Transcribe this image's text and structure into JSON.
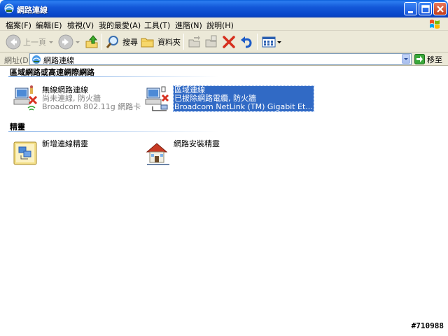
{
  "window": {
    "title": "網路連線",
    "icon": "network-connections-icon"
  },
  "menubar": {
    "items": [
      "檔案(F)",
      "編輯(E)",
      "檢視(V)",
      "我的最愛(A)",
      "工具(T)",
      "進階(N)",
      "說明(H)"
    ]
  },
  "toolbar": {
    "back_label": "上一頁",
    "search_label": "搜尋",
    "folders_label": "資料夾"
  },
  "address": {
    "label": "網址(D)",
    "value": "網路連線",
    "go_label": "移至"
  },
  "groups": [
    {
      "title": "區域網路或高速網際網路",
      "items": [
        {
          "name": "無線網路連線",
          "status": "尚未連線, 防火牆",
          "device": "Broadcom 802.11g 網路卡",
          "icon": "wireless-connection-icon",
          "selected": false
        },
        {
          "name": "區域連線",
          "status": "已拔除網路電纜, 防火牆",
          "device": "Broadcom NetLink (TM) Gigabit Et...",
          "icon": "lan-connection-icon",
          "selected": true
        }
      ]
    },
    {
      "title": "精靈",
      "items": [
        {
          "name": "新增連線精靈",
          "icon": "new-connection-wizard-icon"
        },
        {
          "name": "網路安裝精靈",
          "icon": "network-setup-wizard-icon"
        }
      ]
    }
  ],
  "watermark": "#710988"
}
